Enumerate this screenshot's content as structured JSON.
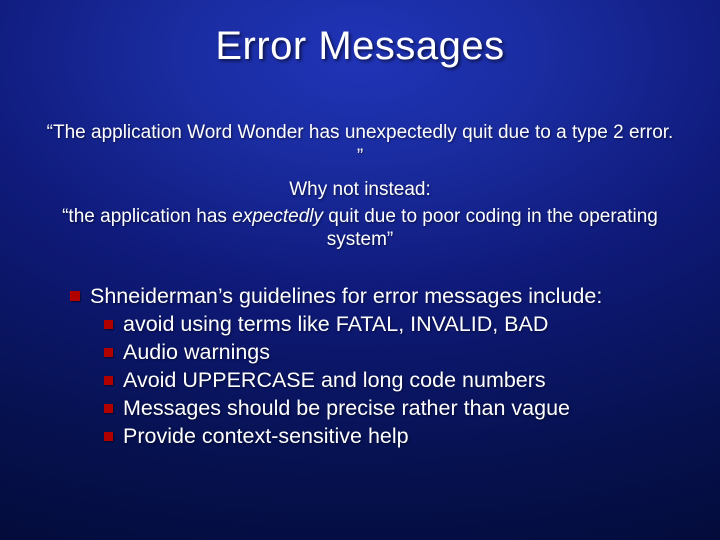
{
  "title": "Error Messages",
  "quote1": "“The application Word Wonder has unexpectedly quit due to a type 2 error. ”",
  "whynot": "Why not instead:",
  "quote2_pre": "“the application has ",
  "quote2_em": "expectedly",
  "quote2_post": " quit due to poor coding in the operating system”",
  "main": "Shneiderman’s  guidelines for error messages include:",
  "subs": {
    "a": "avoid using terms like FATAL, INVALID, BAD",
    "b": "Audio warnings",
    "c": "Avoid UPPERCASE and long code numbers",
    "d": "Messages should be precise rather than vague",
    "e": "Provide context-sensitive help"
  }
}
